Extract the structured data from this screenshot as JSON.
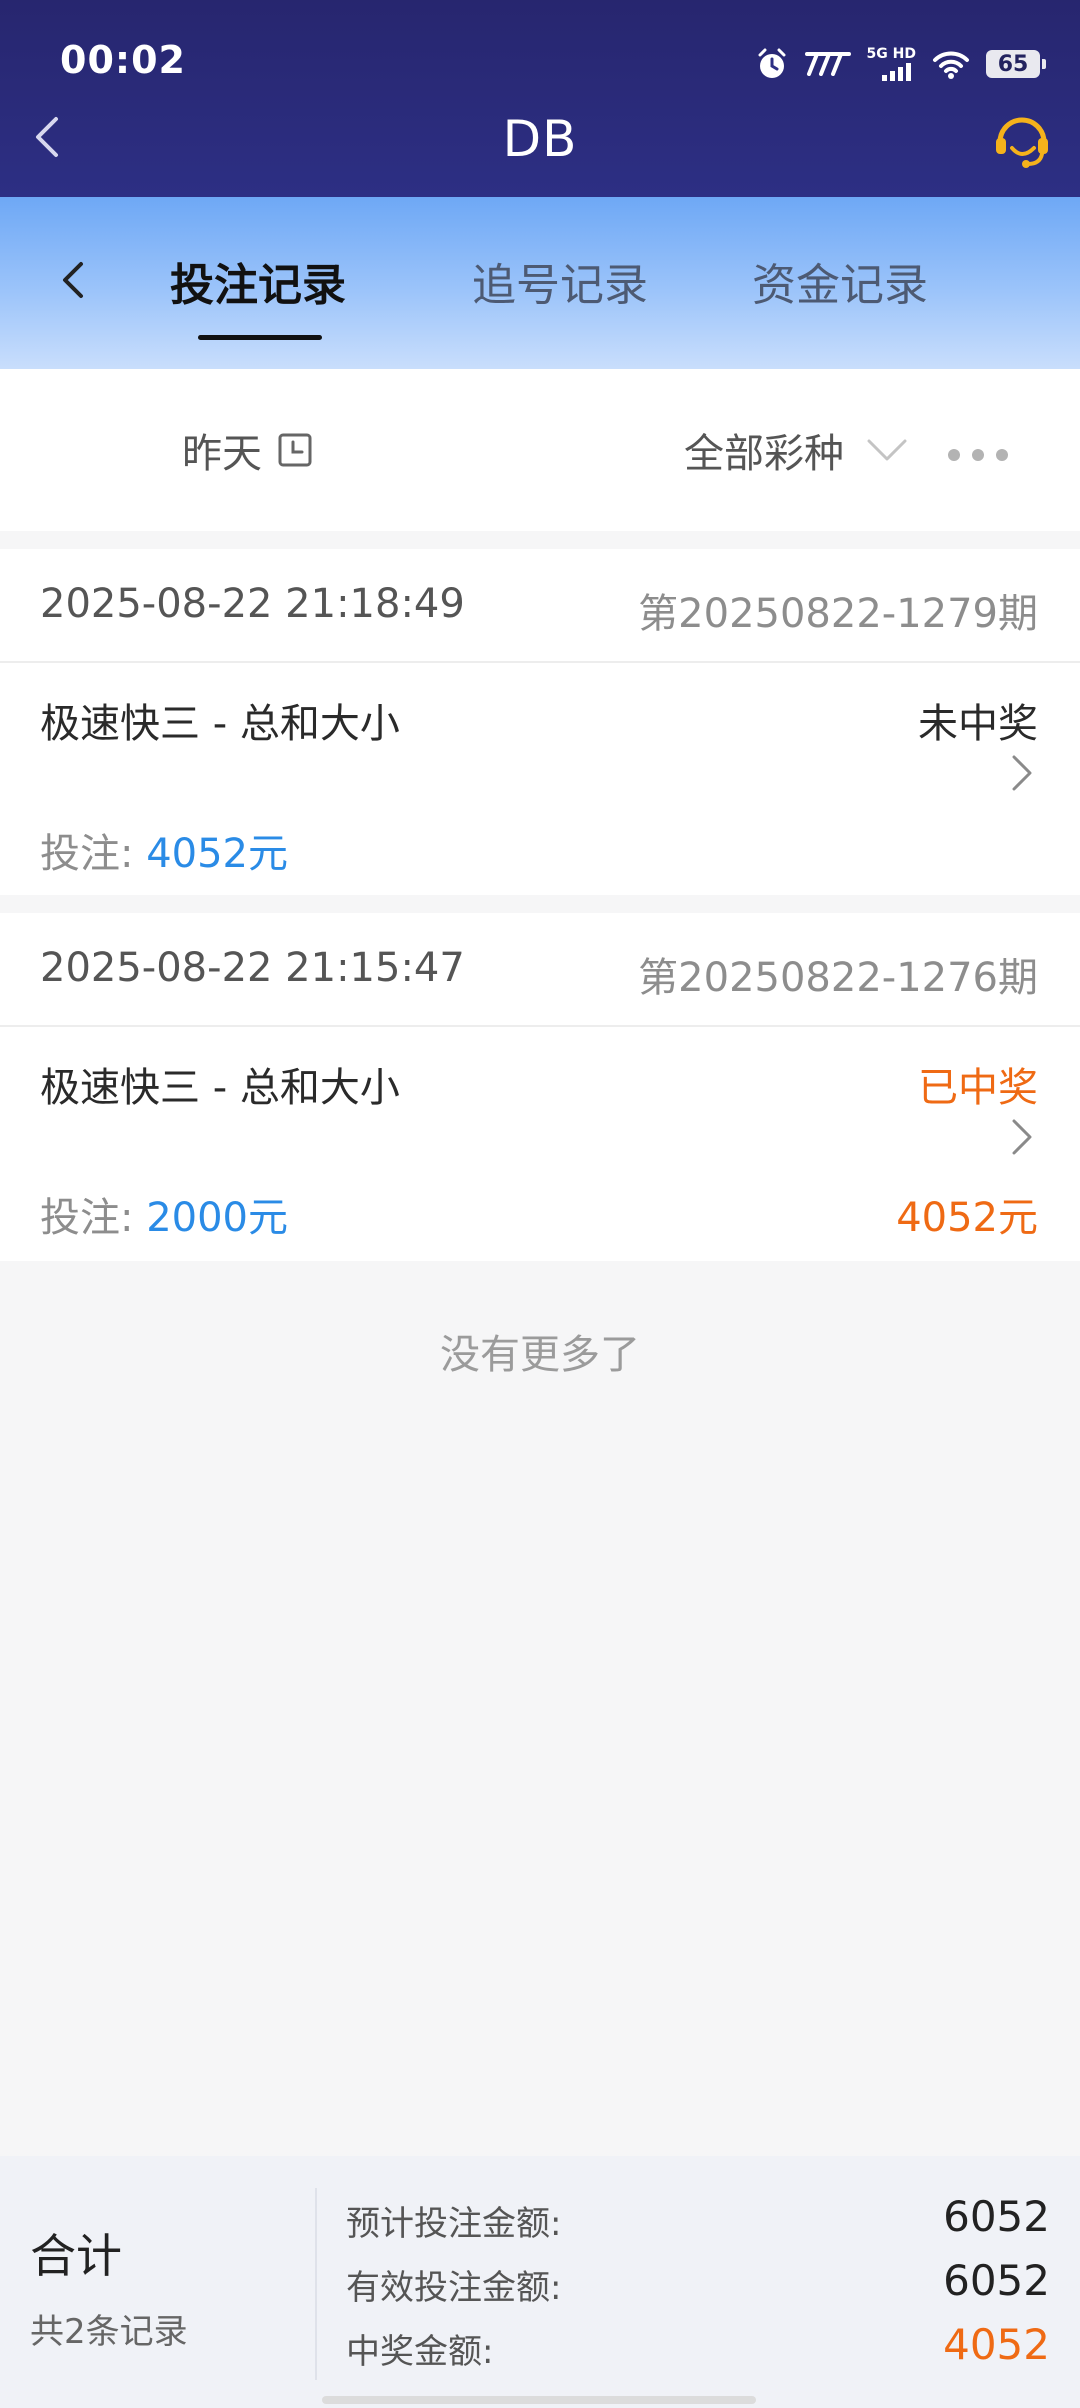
{
  "status_bar": {
    "time": "00:02",
    "network_label": "5G HD",
    "battery": "65"
  },
  "app_bar": {
    "title": "DB"
  },
  "tabs": [
    {
      "label": "投注记录",
      "active": true
    },
    {
      "label": "追号记录",
      "active": false
    },
    {
      "label": "资金记录",
      "active": false
    }
  ],
  "filters": {
    "date": "昨天",
    "lottery": "全部彩种"
  },
  "records": [
    {
      "time": "2025-08-22 21:18:49",
      "period": "第20250822-1279期",
      "game": "极速快三 - 总和大小",
      "status": "未中奖",
      "bet_label": "投注: ",
      "bet_amount": "4052元",
      "win_amount": ""
    },
    {
      "time": "2025-08-22 21:15:47",
      "period": "第20250822-1276期",
      "game": "极速快三 - 总和大小",
      "status": "已中奖",
      "bet_label": "投注: ",
      "bet_amount": "2000元",
      "win_amount": "4052元"
    }
  ],
  "no_more_text": "没有更多了",
  "summary": {
    "title": "合计",
    "count": "共2条记录",
    "expected_label": "预计投注金额:",
    "expected_value": "6052",
    "valid_label": "有效投注金额:",
    "valid_value": "6052",
    "win_label": "中奖金额:",
    "win_value": "4052"
  },
  "colors": {
    "header_bg": "#2d2f84",
    "tab_gradient_top": "#6ea8f5",
    "bet_amount": "#2a8be6",
    "win": "#ef6a14"
  }
}
